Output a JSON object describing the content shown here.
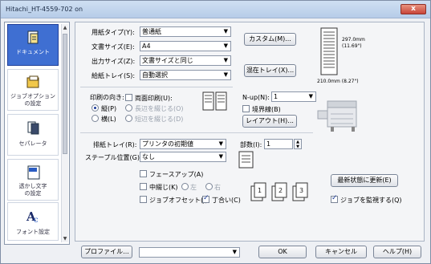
{
  "window": {
    "title": "Hitachi_HT-4559-702 on",
    "close_label": "x"
  },
  "sidebar": {
    "items": [
      {
        "label": "ドキュメント",
        "icon": "document-icon",
        "selected": true
      },
      {
        "label": "ジョブオプション\nの設定",
        "icon": "job-options-icon",
        "selected": false
      },
      {
        "label": "セパレータ",
        "icon": "separator-icon",
        "selected": false
      },
      {
        "label": "透かし文字\nの設定",
        "icon": "watermark-icon",
        "selected": false
      },
      {
        "label": "フォント設定",
        "icon": "font-icon",
        "selected": false
      }
    ]
  },
  "form": {
    "paper_type": {
      "label": "用紙タイプ(Y):",
      "value": "普通紙"
    },
    "doc_size": {
      "label": "文書サイズ(E):",
      "value": "A4"
    },
    "output_size": {
      "label": "出力サイズ(Z):",
      "value": "文書サイズと同じ"
    },
    "paper_tray": {
      "label": "給紙トレイ(S):",
      "value": "自動選択"
    },
    "custom_button": "カスタム(M)...",
    "mixed_tray_button": "混在トレイ(X)...",
    "paper_dims": {
      "height": "297.0mm",
      "height_in": "(11.69\")",
      "width": "210.0mm (8.27\")"
    }
  },
  "orientation": {
    "label": "印刷の向き:",
    "portrait": "縦(P)",
    "landscape": "横(L)",
    "selected": "portrait"
  },
  "duplex": {
    "label": "両面印刷(U):",
    "long_edge": "長辺を綴じる(O)",
    "short_edge": "短辺を綴じる(D)"
  },
  "nup": {
    "label": "N-up(N):",
    "value": "1",
    "border_label": "境界線(B)",
    "layout_button": "レイアウト(H)..."
  },
  "output_tray": {
    "label": "排紙トレイ(R):",
    "value": "プリンタの初期値"
  },
  "copies": {
    "label": "部数(I):",
    "value": "1"
  },
  "staple": {
    "label": "ステープル位置(G):",
    "value": "なし"
  },
  "options": {
    "face_up": "フェースアップ(A)",
    "punch": "中綴じ(K)",
    "punch_left": "左",
    "punch_right": "右",
    "job_offset": "ジョブオフセット(J)",
    "collate": "丁合い(C)",
    "collate_checked": true,
    "update_button": "最新状態に更新(E)",
    "monitor_job": "ジョブを監視する(Q)",
    "monitor_checked": true
  },
  "bottom": {
    "profile_button": "プロファイル...",
    "profile_value": "",
    "ok": "OK",
    "cancel": "キャンセル",
    "help": "ヘルプ(H)"
  }
}
